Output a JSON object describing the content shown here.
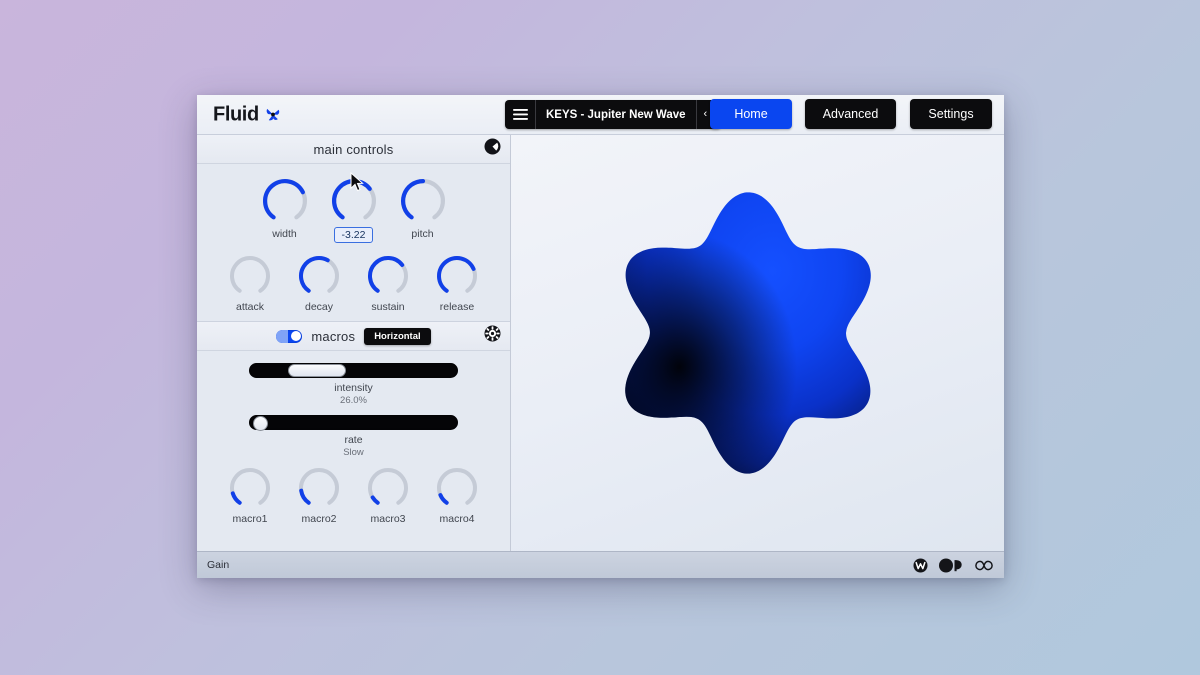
{
  "app": {
    "brand_name": "Fluid",
    "brand_mark_icon": "butterfly-logo-icon"
  },
  "topbar": {
    "menu_icon": "hamburger-menu-icon",
    "preset_name": "KEYS - Jupiter New Wave",
    "preset_prev_label": "‹",
    "preset_next_label": "›",
    "tabs": [
      {
        "label": "Home",
        "active": true
      },
      {
        "label": "Advanced",
        "active": false
      },
      {
        "label": "Settings",
        "active": false
      }
    ],
    "accent_color": "#0a46f0",
    "tab_bg_color": "#0c0c0e"
  },
  "main_controls": {
    "title": "main controls",
    "header_icon": "preset-morph-icon",
    "row1": [
      {
        "label": "width",
        "value_pct": 72,
        "has_value_box": false
      },
      {
        "label": "",
        "value_pct": 68,
        "has_value_box": true,
        "value_text": "-3.22"
      },
      {
        "label": "pitch",
        "value_pct": 50,
        "has_value_box": false
      }
    ],
    "row2": [
      {
        "label": "attack",
        "value_pct": 0
      },
      {
        "label": "decay",
        "value_pct": 60
      },
      {
        "label": "sustain",
        "value_pct": 68
      },
      {
        "label": "release",
        "value_pct": 73
      }
    ]
  },
  "macros": {
    "title": "macros",
    "enabled": true,
    "layout_option": "Horizontal",
    "settings_icon": "gear-icon",
    "sliders": [
      {
        "name": "intensity",
        "value_text": "26.0%",
        "fill_pct": 26,
        "handle": "wide"
      },
      {
        "name": "rate",
        "value_text": "Slow",
        "fill_pct": 2,
        "handle": "round"
      }
    ],
    "knobs": [
      {
        "label": "macro1",
        "value_pct": 13
      },
      {
        "label": "macro2",
        "value_pct": 16
      },
      {
        "label": "macro3",
        "value_pct": 8
      },
      {
        "label": "macro4",
        "value_pct": 11
      }
    ]
  },
  "visualizer": {
    "shape_name": "blob-6-lobe",
    "blob_color": "#0a3fe0",
    "blob_shadow_color": "#000000",
    "lobes": 6
  },
  "status_bar": {
    "text": "Gain",
    "icons": [
      {
        "name": "wavetable-icon"
      },
      {
        "name": "filter-icon"
      },
      {
        "name": "infinity-icon"
      }
    ]
  }
}
